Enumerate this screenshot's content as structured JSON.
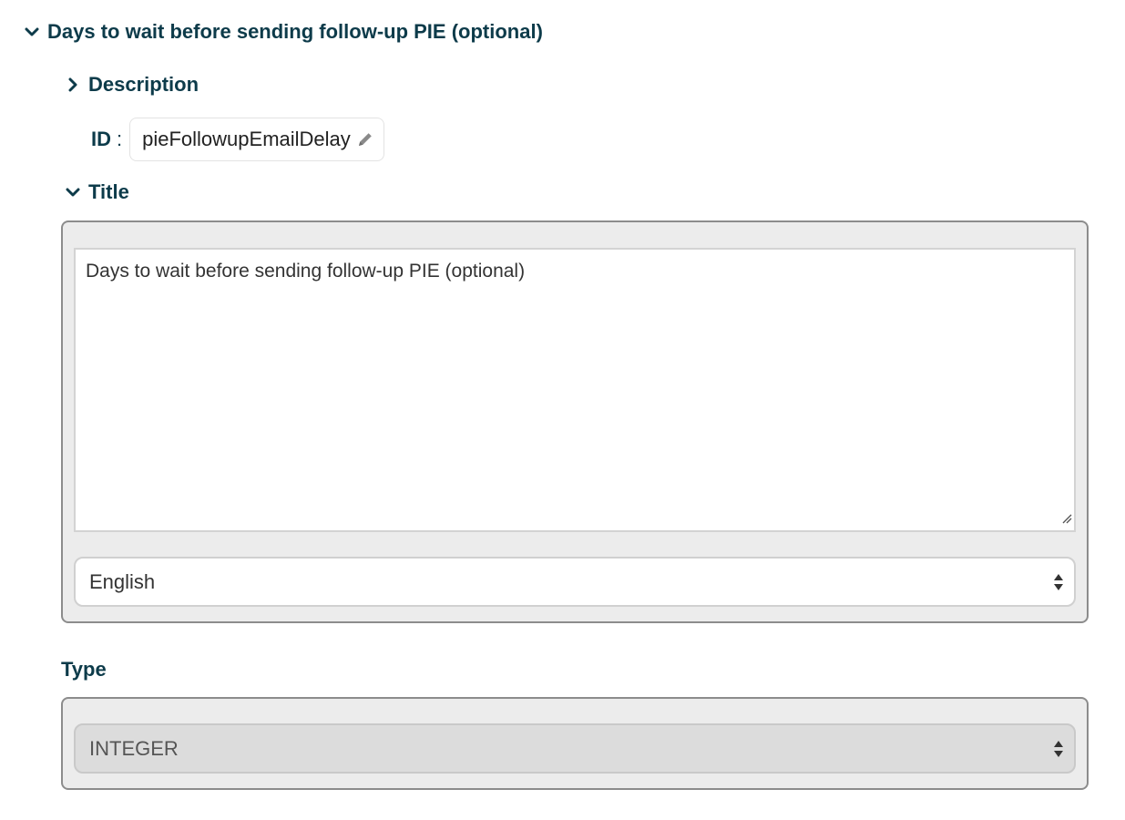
{
  "main_section": {
    "title": "Days to wait before sending follow-up PIE (optional)",
    "expanded": true
  },
  "description": {
    "label": "Description",
    "expanded": false
  },
  "id_field": {
    "label": "ID",
    "separator": ":",
    "value": "pieFollowupEmailDelay"
  },
  "title_section": {
    "label": "Title",
    "expanded": true,
    "text_value": "Days to wait before sending follow-up PIE (optional)",
    "language": "English"
  },
  "type_section": {
    "label": "Type",
    "value": "INTEGER"
  },
  "icons": {
    "expanded": "chevron-down-icon",
    "collapsed": "chevron-right-icon",
    "edit": "pencil-icon",
    "select": "select-arrows-icon",
    "resize": "resize-grip-icon"
  },
  "colors": {
    "heading": "#0d3b4a",
    "panel_bg": "#ececec",
    "panel_border": "#8c8c8c"
  }
}
